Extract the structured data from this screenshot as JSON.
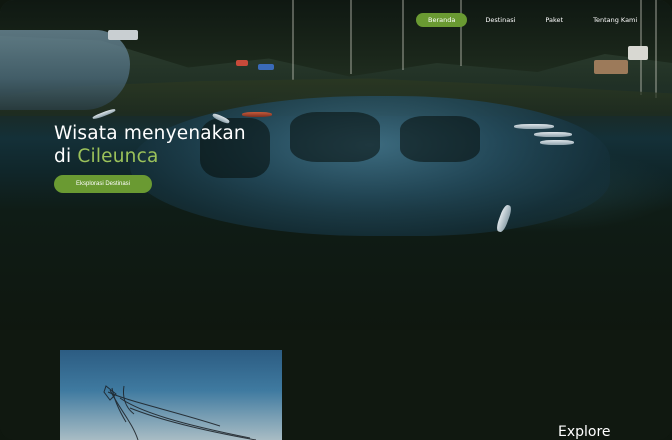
{
  "nav": {
    "items": [
      {
        "label": "Beranda",
        "active": true
      },
      {
        "label": "Destinasi",
        "active": false
      },
      {
        "label": "Paket",
        "active": false
      },
      {
        "label": "Tentang Kami",
        "active": false
      }
    ]
  },
  "hero": {
    "title_line1": "Wisata menyenakan",
    "title_prefix": "di ",
    "title_highlight": "Cileunca",
    "cta_label": "Eksplorasi Destinasi"
  },
  "section": {
    "heading": "Explore"
  },
  "colors": {
    "accent": "#6a9a32",
    "highlight_text": "#9bc25a",
    "background": "#101810"
  }
}
